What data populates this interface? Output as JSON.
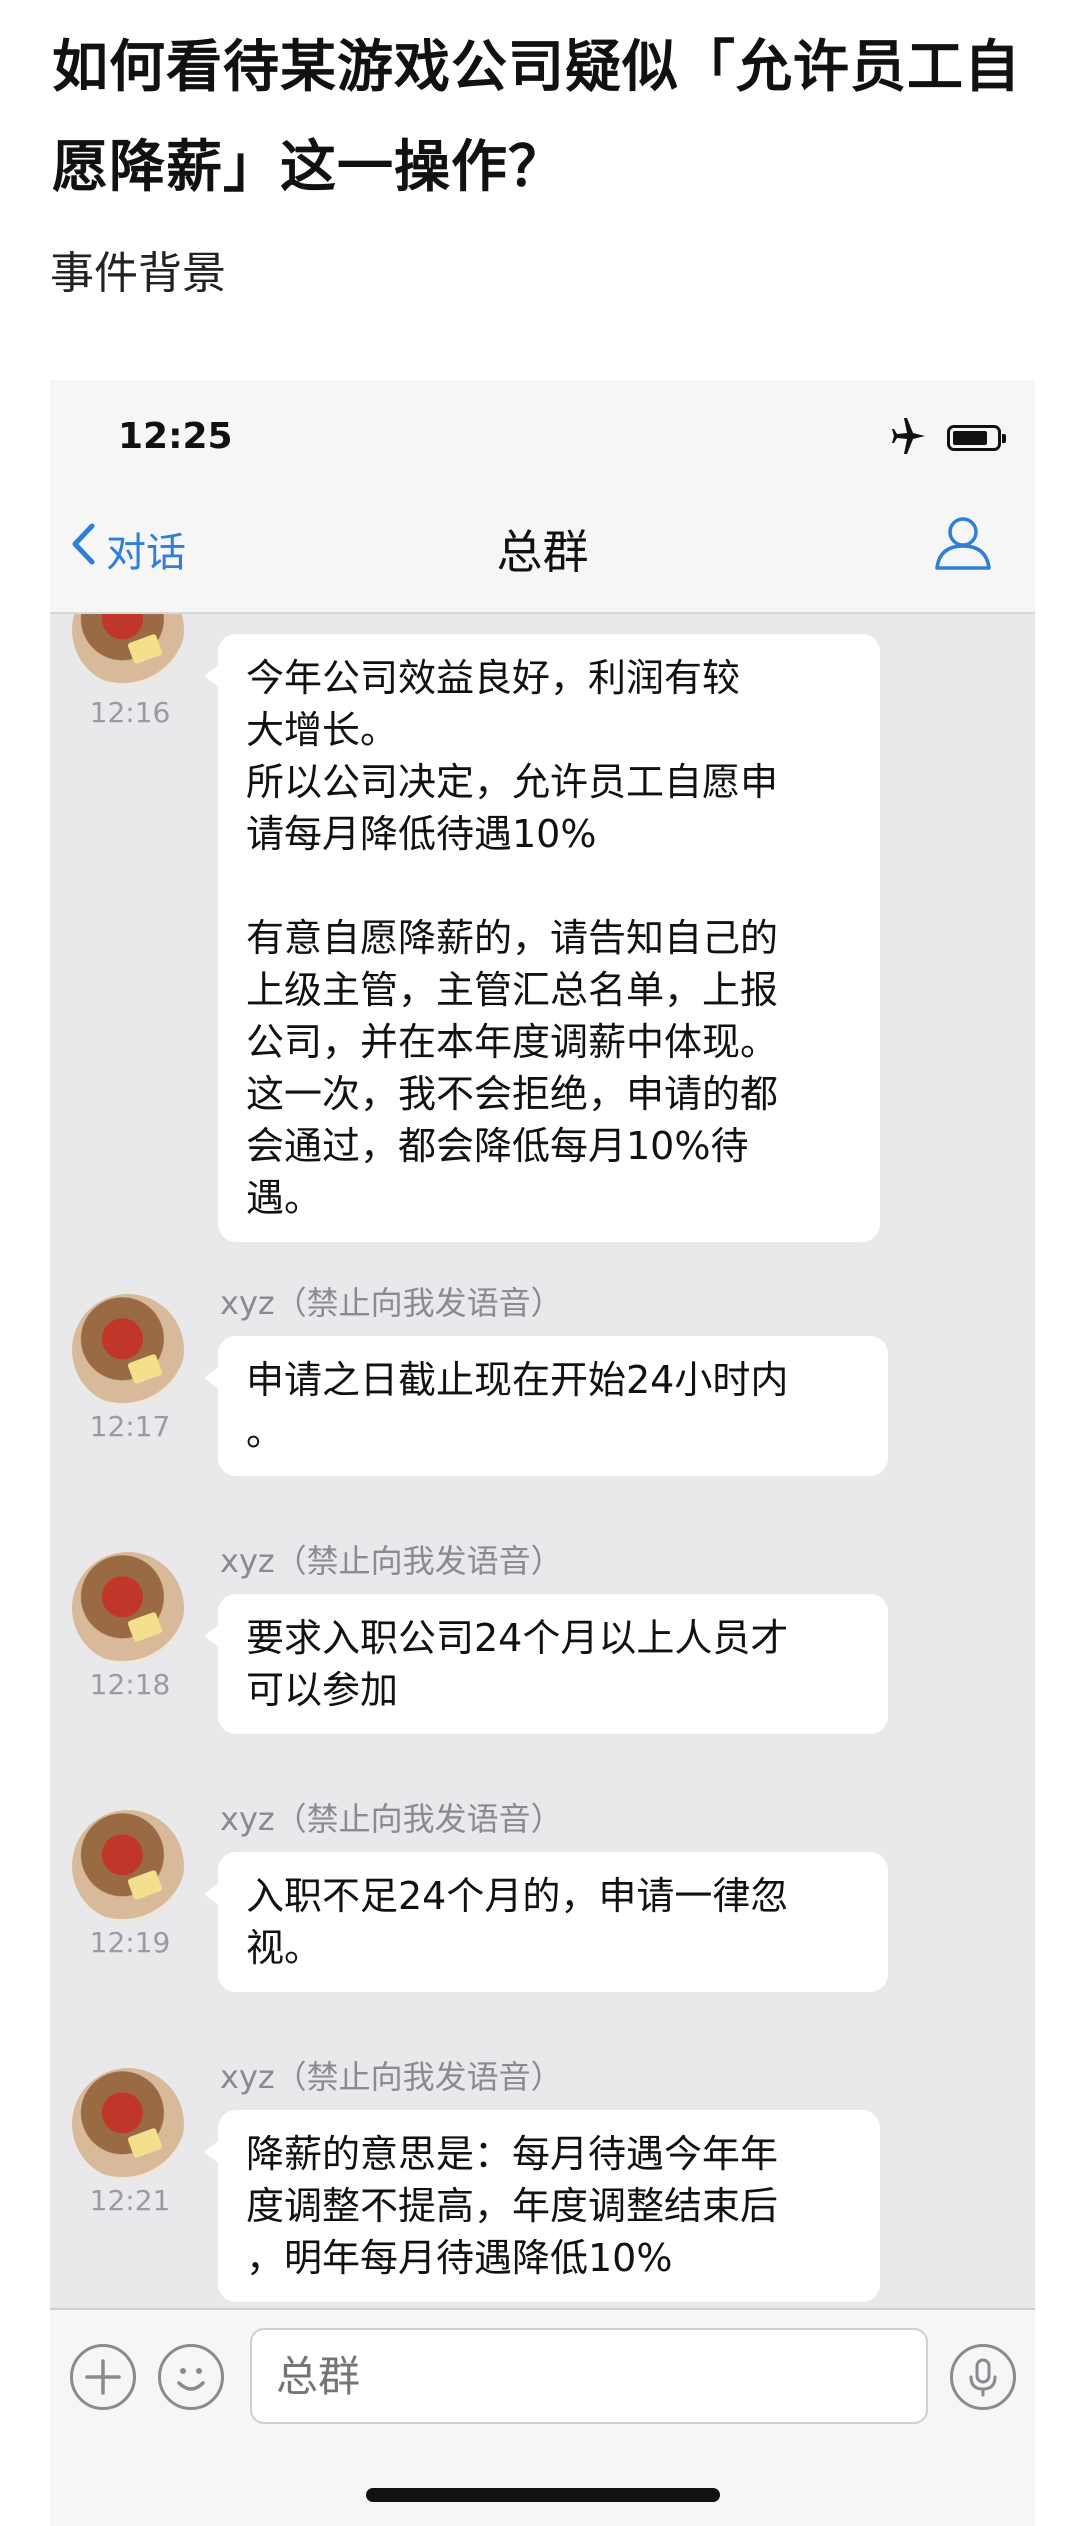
{
  "article": {
    "title": "如何看待某游戏公司疑似「允许员工自愿降薪」这一操作？",
    "subtitle": "事件背景"
  },
  "phone": {
    "status_time": "12:25",
    "status_icons": [
      "airplane-icon",
      "battery-icon"
    ],
    "back_label": "对话",
    "chat_title": "总群",
    "input_placeholder": "总群"
  },
  "messages": [
    {
      "time": "12:16",
      "sender": "",
      "text": "今年公司效益良好，利润有较\n大增长。\n所以公司决定，允许员工自愿申\n请每月降低待遇10%\n\n有意自愿降薪的，请告知自己的\n上级主管，主管汇总名单，上报\n公司，并在本年度调薪中体现。\n这一次，我不会拒绝，申请的都\n会通过，都会降低每月10%待\n遇。"
    },
    {
      "time": "12:17",
      "sender": "xyz（禁止向我发语音）",
      "text": "申请之日截止现在开始24小时内\n。"
    },
    {
      "time": "12:18",
      "sender": "xyz（禁止向我发语音）",
      "text": "要求入职公司24个月以上人员才\n可以参加"
    },
    {
      "time": "12:19",
      "sender": "xyz（禁止向我发语音）",
      "text": "入职不足24个月的，申请一律忽\n视。"
    },
    {
      "time": "12:21",
      "sender": "xyz（禁止向我发语音）",
      "text": "降薪的意思是：每月待遇今年年\n度调整不提高，年度调整结束后\n，明年每月待遇降低10%"
    }
  ],
  "colors": {
    "accent": "#2f7ed8",
    "chat_bg": "#e9e9ec",
    "bubble": "#ffffff"
  }
}
